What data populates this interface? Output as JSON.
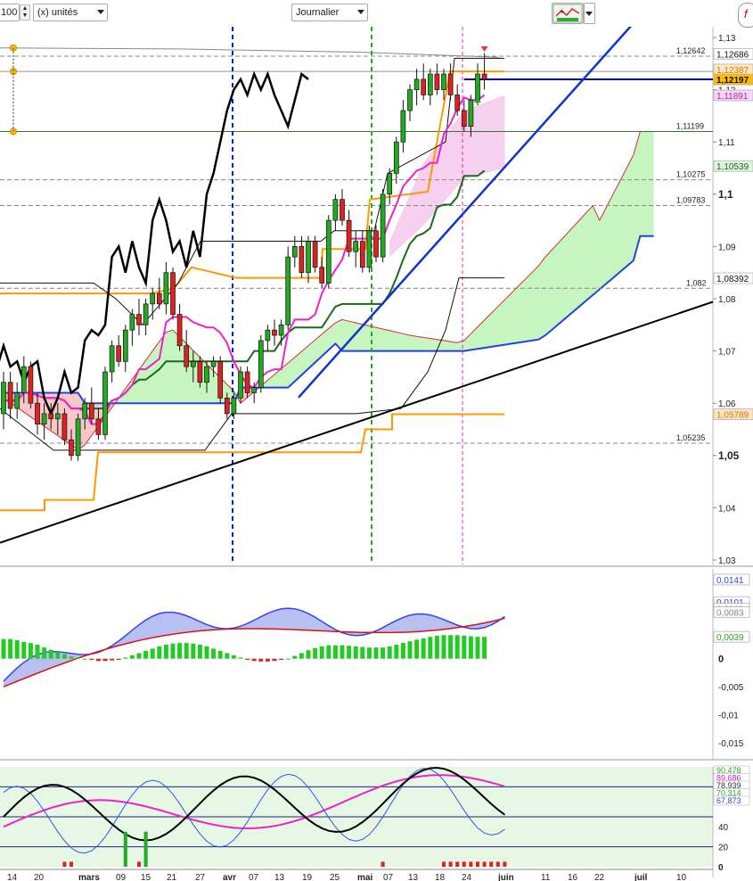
{
  "toolbar": {
    "period_value": "100",
    "units_label": "(x) unités",
    "interval_label": "Journalier"
  },
  "colors": {
    "candle_up": "#22aa22",
    "candle_down": "#dd2222",
    "tenkan": "#ee22cc",
    "kijun": "#1a6a1a",
    "chikou": "#000000",
    "ssb": "#2244dd",
    "kumo_bull": "#c7f5c0",
    "kumo_bear": "#f8c8c8",
    "orange_levels": "#ff9900",
    "trendline_blue": "#1133cc",
    "trendline_black": "#000000",
    "macd_blue": "#3344ee",
    "macd_red": "#dd1111",
    "hist_green": "#22cc22",
    "price_marker": "#ffbb00",
    "navy_line": "#000088"
  },
  "icons": [
    "spin-arrows-icon",
    "dropdown-arrow-icon",
    "indicator-tool-icon",
    "dropdown-arrow-icon",
    "side-scroll-icon",
    "sell-signal-icon",
    "buy-signal-icon"
  ],
  "chart_data": [
    {
      "type": "candlestick",
      "title": "",
      "x_tick_labels": [
        "14",
        "20",
        "mars",
        "09",
        "15",
        "21",
        "27",
        "avr",
        "07",
        "13",
        "19",
        "25",
        "mai",
        "07",
        "13",
        "18",
        "24",
        "juin",
        "11",
        "16",
        "22",
        "juil",
        "10"
      ],
      "y_ticks": [
        "1,13",
        "1,12",
        "1,11",
        "1,1",
        "1,09",
        "1,08",
        "1,07",
        "1,06",
        "1,05",
        "1,04",
        "1,03"
      ],
      "ylim": [
        1.03,
        1.13
      ],
      "price_labels": [
        {
          "text": "1,12686",
          "value": 1.12686
        },
        {
          "text": "1,12387",
          "value": 1.12387
        },
        {
          "text": "1,12197",
          "value": 1.12197
        },
        {
          "text": "1,11891",
          "value": 1.11891
        },
        {
          "text": "1,10539",
          "value": 1.10539
        },
        {
          "text": "1,08392",
          "value": 1.08392
        },
        {
          "text": "1,05789",
          "value": 1.05789
        }
      ],
      "level_labels": [
        {
          "text": "1,12642",
          "value": 1.12642
        },
        {
          "text": "1,11199",
          "value": 1.11199
        },
        {
          "text": "1,10275",
          "value": 1.10275
        },
        {
          "text": "1,09783",
          "value": 1.09783
        },
        {
          "text": "1,082",
          "value": 1.082
        },
        {
          "text": "1,05235",
          "value": 1.05235
        }
      ],
      "candles": [
        [
          1.058,
          1.066,
          1.055,
          1.064
        ],
        [
          1.064,
          1.066,
          1.057,
          1.059
        ],
        [
          1.059,
          1.064,
          1.057,
          1.062
        ],
        [
          1.062,
          1.069,
          1.06,
          1.067
        ],
        [
          1.067,
          1.068,
          1.059,
          1.06
        ],
        [
          1.06,
          1.062,
          1.054,
          1.056
        ],
        [
          1.056,
          1.06,
          1.053,
          1.058
        ],
        [
          1.058,
          1.06,
          1.055,
          1.057
        ],
        [
          1.057,
          1.06,
          1.054,
          1.058
        ],
        [
          1.058,
          1.059,
          1.052,
          1.053
        ],
        [
          1.053,
          1.055,
          1.049,
          1.05
        ],
        [
          1.05,
          1.058,
          1.049,
          1.057
        ],
        [
          1.057,
          1.061,
          1.055,
          1.06
        ],
        [
          1.06,
          1.063,
          1.056,
          1.057
        ],
        [
          1.057,
          1.059,
          1.053,
          1.054
        ],
        [
          1.054,
          1.067,
          1.053,
          1.066
        ],
        [
          1.066,
          1.072,
          1.064,
          1.071
        ],
        [
          1.071,
          1.073,
          1.067,
          1.068
        ],
        [
          1.068,
          1.075,
          1.066,
          1.074
        ],
        [
          1.074,
          1.078,
          1.071,
          1.077
        ],
        [
          1.077,
          1.08,
          1.073,
          1.075
        ],
        [
          1.075,
          1.08,
          1.073,
          1.079
        ],
        [
          1.079,
          1.082,
          1.076,
          1.081
        ],
        [
          1.081,
          1.084,
          1.078,
          1.079
        ],
        [
          1.079,
          1.087,
          1.077,
          1.085
        ],
        [
          1.085,
          1.086,
          1.076,
          1.077
        ],
        [
          1.077,
          1.079,
          1.07,
          1.071
        ],
        [
          1.071,
          1.074,
          1.066,
          1.067
        ],
        [
          1.067,
          1.07,
          1.064,
          1.068
        ],
        [
          1.068,
          1.069,
          1.063,
          1.064
        ],
        [
          1.064,
          1.068,
          1.062,
          1.067
        ],
        [
          1.067,
          1.069,
          1.065,
          1.068
        ],
        [
          1.068,
          1.069,
          1.06,
          1.061
        ],
        [
          1.061,
          1.062,
          1.057,
          1.058
        ],
        [
          1.058,
          1.062,
          1.057,
          1.061
        ],
        [
          1.061,
          1.067,
          1.06,
          1.066
        ],
        [
          1.066,
          1.067,
          1.061,
          1.062
        ],
        [
          1.062,
          1.064,
          1.06,
          1.063
        ],
        [
          1.063,
          1.073,
          1.062,
          1.072
        ],
        [
          1.072,
          1.075,
          1.07,
          1.074
        ],
        [
          1.074,
          1.076,
          1.071,
          1.073
        ],
        [
          1.073,
          1.076,
          1.071,
          1.075
        ],
        [
          1.075,
          1.09,
          1.074,
          1.088
        ],
        [
          1.088,
          1.092,
          1.086,
          1.09
        ],
        [
          1.09,
          1.092,
          1.084,
          1.085
        ],
        [
          1.085,
          1.092,
          1.083,
          1.091
        ],
        [
          1.091,
          1.092,
          1.085,
          1.086
        ],
        [
          1.086,
          1.088,
          1.082,
          1.083
        ],
        [
          1.083,
          1.096,
          1.082,
          1.095
        ],
        [
          1.095,
          1.1,
          1.093,
          1.099
        ],
        [
          1.099,
          1.101,
          1.094,
          1.095
        ],
        [
          1.095,
          1.097,
          1.088,
          1.089
        ],
        [
          1.089,
          1.093,
          1.086,
          1.091
        ],
        [
          1.091,
          1.093,
          1.085,
          1.086
        ],
        [
          1.086,
          1.094,
          1.085,
          1.093
        ],
        [
          1.093,
          1.094,
          1.087,
          1.088
        ],
        [
          1.088,
          1.101,
          1.087,
          1.1
        ],
        [
          1.1,
          1.105,
          1.098,
          1.104
        ],
        [
          1.104,
          1.111,
          1.102,
          1.11
        ],
        [
          1.11,
          1.118,
          1.108,
          1.116
        ],
        [
          1.116,
          1.121,
          1.114,
          1.12
        ],
        [
          1.12,
          1.124,
          1.117,
          1.122
        ],
        [
          1.122,
          1.125,
          1.118,
          1.119
        ],
        [
          1.119,
          1.124,
          1.117,
          1.123
        ],
        [
          1.123,
          1.125,
          1.119,
          1.12
        ],
        [
          1.12,
          1.124,
          1.118,
          1.123
        ],
        [
          1.123,
          1.125,
          1.118,
          1.119
        ],
        [
          1.119,
          1.121,
          1.115,
          1.116
        ],
        [
          1.116,
          1.118,
          1.112,
          1.113
        ],
        [
          1.113,
          1.119,
          1.111,
          1.118
        ],
        [
          1.118,
          1.125,
          1.117,
          1.123
        ],
        [
          1.123,
          1.127,
          1.12,
          1.122
        ]
      ]
    },
    {
      "type": "line",
      "title": "",
      "y_ticks": [
        "0",
        "-0,005",
        "-0,01",
        "-0,015"
      ],
      "ylim": [
        -0.018,
        0.016
      ],
      "value_labels": [
        "0,0141",
        "0,0101",
        "0,0089",
        "0,0083",
        "0,0039"
      ],
      "histogram": [
        0.0035,
        0.0035,
        0.0033,
        0.003,
        0.0028,
        0.0025,
        0.002,
        0.0016,
        0.0012,
        0.0008,
        0.0004,
        0.0002,
        0,
        -0.0002,
        -0.0004,
        -0.0004,
        -0.0003,
        -0.0002,
        0.0002,
        0.0006,
        0.001,
        0.0014,
        0.0018,
        0.0022,
        0.0025,
        0.0027,
        0.0028,
        0.0028,
        0.0027,
        0.0025,
        0.0022,
        0.0018,
        0.0014,
        0.001,
        0.0006,
        0.0002,
        -0.0002,
        -0.0004,
        -0.0005,
        -0.0005,
        -0.0004,
        -0.0002,
        0,
        0.0005,
        0.001,
        0.0015,
        0.0019,
        0.0022,
        0.0024,
        0.0024,
        0.0024,
        0.0023,
        0.0022,
        0.0021,
        0.002,
        0.002,
        0.002,
        0.0022,
        0.0025,
        0.0028,
        0.0031,
        0.0034,
        0.0036,
        0.0039,
        0.0041,
        0.0042,
        0.0042,
        0.0042,
        0.0041,
        0.004,
        0.0039,
        0.0039
      ]
    },
    {
      "type": "line",
      "title": "",
      "y_ticks": [
        "40",
        "20",
        "0"
      ],
      "ylim": [
        0,
        100
      ],
      "value_labels": [
        "90,478",
        "89,686",
        "78,939",
        "70,314",
        "67,873"
      ]
    }
  ]
}
